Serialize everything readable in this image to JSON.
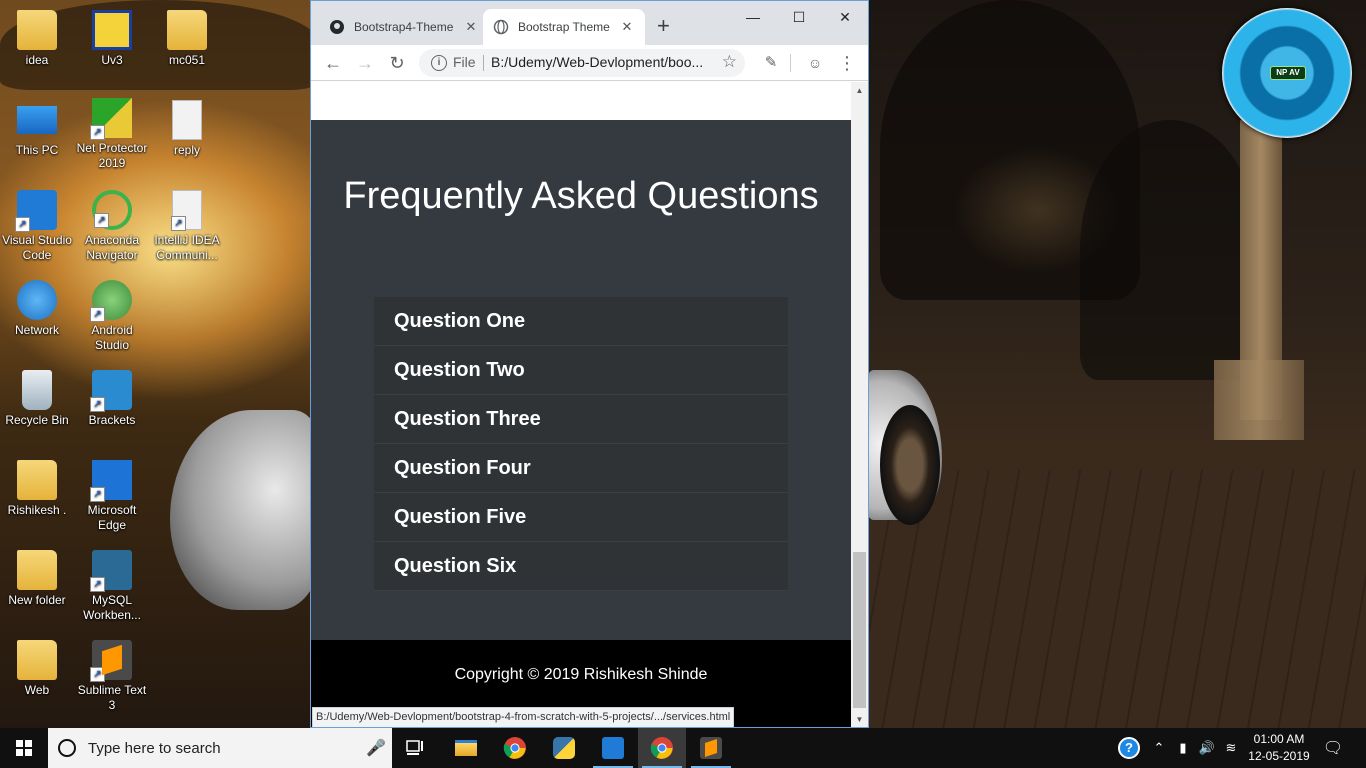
{
  "desktop": {
    "icons": [
      {
        "label": "idea"
      },
      {
        "label": "Uv3"
      },
      {
        "label": "mc051"
      },
      {
        "label": "This PC"
      },
      {
        "label": "Net Protector 2019"
      },
      {
        "label": "reply"
      },
      {
        "label": "Visual Studio Code"
      },
      {
        "label": "Anaconda Navigator"
      },
      {
        "label": "IntelliJ IDEA Communi..."
      },
      {
        "label": "Network"
      },
      {
        "label": "Android Studio"
      },
      {
        "label": "Recycle Bin"
      },
      {
        "label": "Brackets"
      },
      {
        "label": "Rishikesh ."
      },
      {
        "label": "Microsoft Edge"
      },
      {
        "label": "New folder"
      },
      {
        "label": "MySQL Workben..."
      },
      {
        "label": "Web"
      },
      {
        "label": "Sublime Text 3"
      }
    ],
    "widget": {
      "badge": "NP AV"
    }
  },
  "browser": {
    "tabs": [
      {
        "title": "Bootstrap4-Theme",
        "icon": "github-icon"
      },
      {
        "title": "Bootstrap Theme",
        "icon": "globe-icon"
      }
    ],
    "omnibox": {
      "scheme_label": "File",
      "url": "B:/Udemy/Web-Devlopment/boo..."
    },
    "page": {
      "faq_title": "Frequently Asked Questions",
      "questions": [
        "Question One",
        "Question Two",
        "Question Three",
        "Question Four",
        "Question Five",
        "Question Six"
      ],
      "footer": "Copyright © 2019 Rishikesh Shinde"
    },
    "status_url": "B:/Udemy/Web-Devlopment/bootstrap-4-from-scratch-with-5-projects/.../services.html"
  },
  "taskbar": {
    "search_placeholder": "Type here to search",
    "clock": {
      "time": "01:00 AM",
      "date": "12-05-2019"
    }
  },
  "colors": {
    "faq_bg": "#343a40",
    "footer_bg": "#000000",
    "accent": "#76b9ed"
  }
}
